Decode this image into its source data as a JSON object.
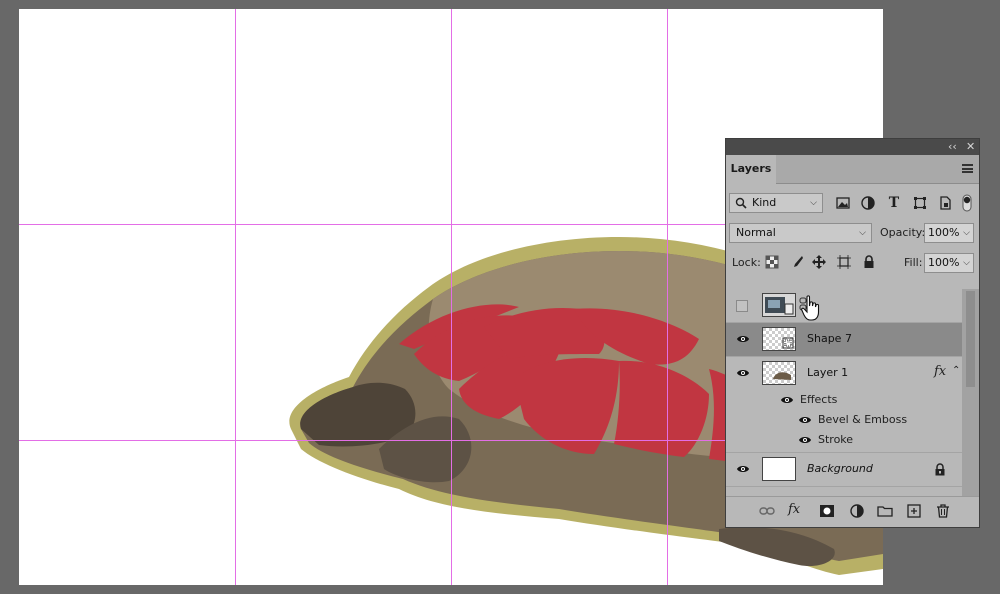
{
  "layers_panel": {
    "tab_title": "Layers",
    "filter_kind": "Kind",
    "blend_mode": "Normal",
    "opacity_label": "Opacity:",
    "opacity_value": "100%",
    "lock_label": "Lock:",
    "fill_label": "Fill:",
    "fill_value": "100%",
    "collapse_glyph": "‹‹",
    "close_glyph": "✕",
    "fx_label": "fx",
    "layers": [
      {
        "name": "",
        "visible": false
      },
      {
        "name": "Shape 7",
        "visible": true,
        "selected": true
      },
      {
        "name": "Layer 1",
        "visible": true
      },
      {
        "name": "Effects",
        "visible": true
      },
      {
        "name": "Bevel & Emboss",
        "visible": true
      },
      {
        "name": "Stroke",
        "visible": true
      },
      {
        "name": "Background",
        "visible": true,
        "locked": true
      }
    ]
  },
  "colors": {
    "guide": "#e36ee6",
    "shape_red": "#c13641",
    "stroke_gold": "#a9a24e"
  }
}
